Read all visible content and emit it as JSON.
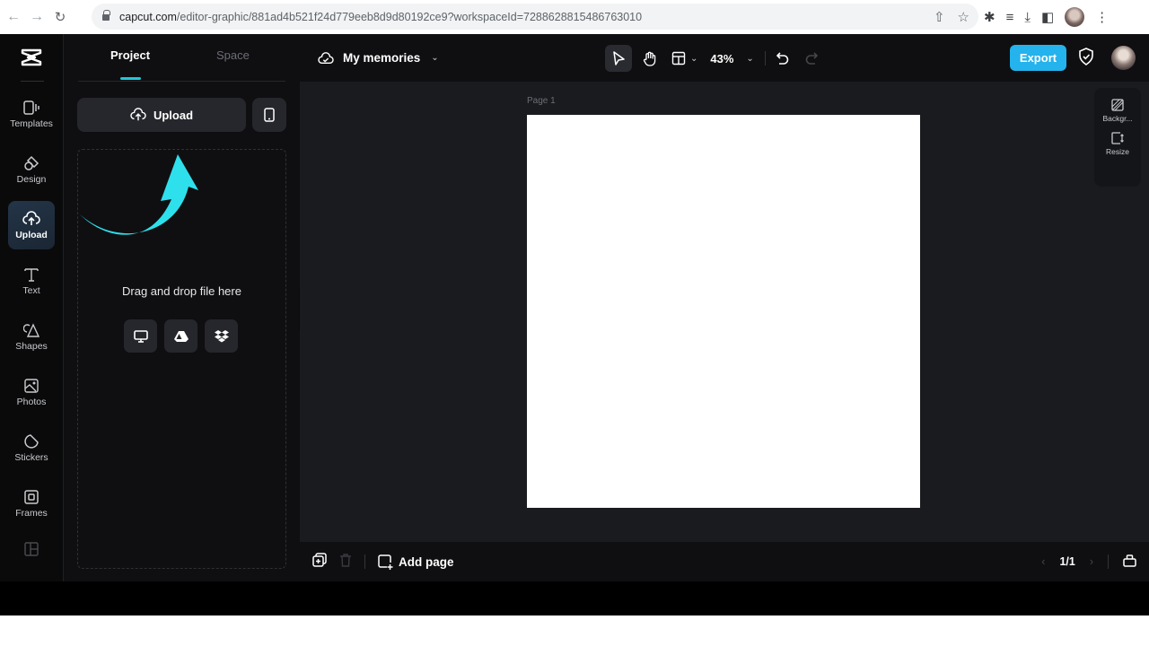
{
  "browser": {
    "url_host": "capcut.com",
    "url_path": "/editor-graphic/881ad4b521f24d779eeb8d9d80192ce9?workspaceId=7288628815486763010",
    "nav": {
      "back": "back-icon",
      "forward": "forward-icon",
      "reload": "reload-icon"
    },
    "omnibox_icons": [
      "share-icon",
      "bookmark-star-icon"
    ],
    "toolbar_icons": [
      "extensions-icon",
      "media-control-icon",
      "download-icon",
      "side-panel-icon",
      "profile-avatar",
      "menu-icon"
    ]
  },
  "rail": {
    "items": [
      {
        "label": "Templates",
        "icon": "templates-icon",
        "active": false
      },
      {
        "label": "Design",
        "icon": "design-icon",
        "active": false
      },
      {
        "label": "Upload",
        "icon": "upload-cloud-icon",
        "active": true
      },
      {
        "label": "Text",
        "icon": "text-icon",
        "active": false
      },
      {
        "label": "Shapes",
        "icon": "shapes-icon",
        "active": false
      },
      {
        "label": "Photos",
        "icon": "photos-icon",
        "active": false
      },
      {
        "label": "Stickers",
        "icon": "stickers-icon",
        "active": false
      },
      {
        "label": "Frames",
        "icon": "frames-icon",
        "active": false
      },
      {
        "label": "",
        "icon": "layout-icon",
        "active": false
      }
    ]
  },
  "panel": {
    "tabs": [
      {
        "label": "Project",
        "active": true
      },
      {
        "label": "Space",
        "active": false
      }
    ],
    "upload_label": "Upload",
    "drop_text": "Drag and drop file here",
    "sources": [
      "computer-icon",
      "google-drive-icon",
      "dropbox-icon"
    ]
  },
  "topbar": {
    "doc_title": "My memories",
    "zoom": "43%",
    "export_label": "Export"
  },
  "canvas": {
    "page_label": "Page 1",
    "side_tools": [
      {
        "label": "Backgr...",
        "icon": "background-icon"
      },
      {
        "label": "Resize",
        "icon": "resize-icon"
      }
    ]
  },
  "bottombar": {
    "add_page_label": "Add page",
    "page_indicator": "1/1"
  },
  "colors": {
    "accent": "#22c6d8",
    "export": "#24b3ec",
    "arrow": "#2ee0ec"
  }
}
